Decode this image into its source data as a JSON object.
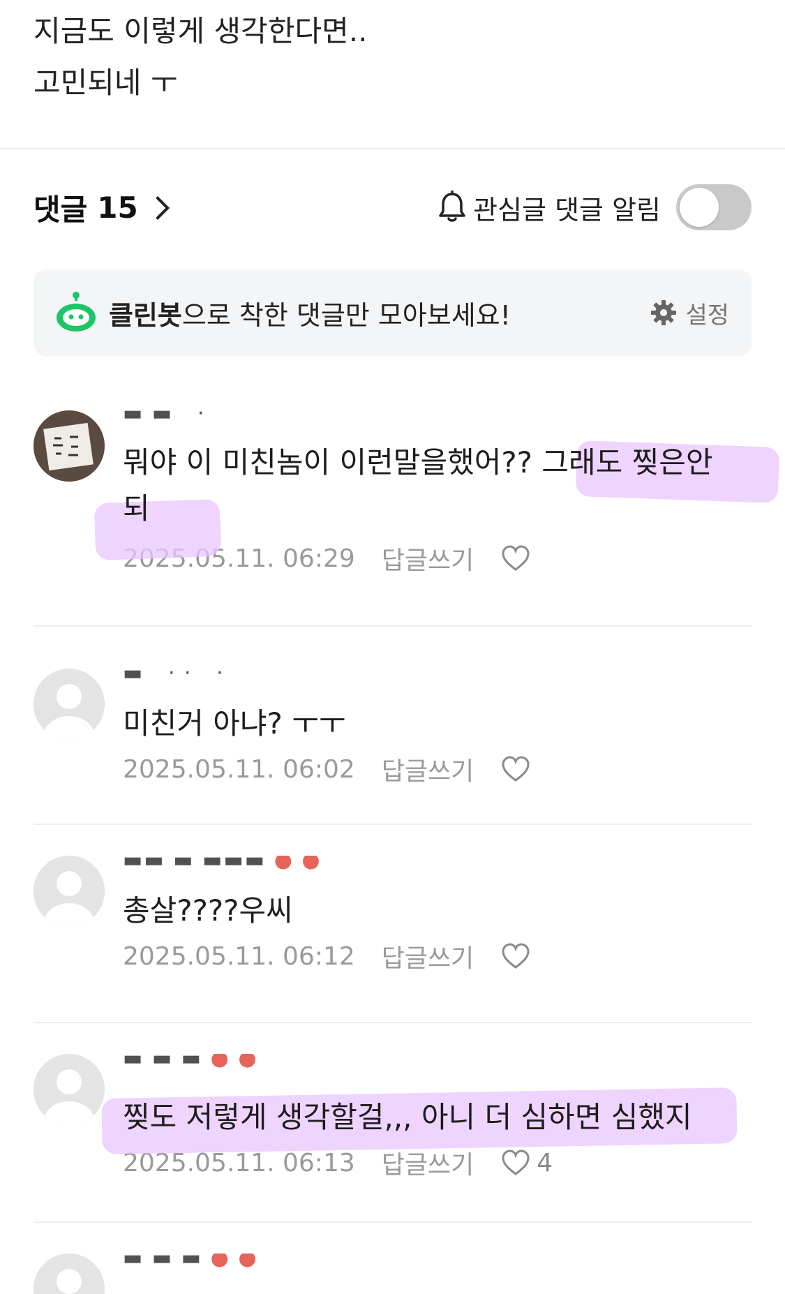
{
  "post": {
    "lines": [
      "지금도 이렇게 생각한다면..",
      "고민되네 ㅜ"
    ]
  },
  "comments_header": {
    "title": "댓글",
    "count": "15",
    "alert_label": "관심글 댓글 알림",
    "alert_enabled": false
  },
  "cleanbot": {
    "brand": "클린봇",
    "message": "으로 착한 댓글만 모아보세요!",
    "settings_label": "설정",
    "icon_color": "#1ec567"
  },
  "comments": [
    {
      "text_lines": [
        "뭐야 이 미친놈이 이런말을했어?? 그래도 찢은안",
        "되"
      ],
      "date": "2025.05.11. 06:29",
      "reply_label": "답글쓰기",
      "likes": ""
    },
    {
      "text_lines": [
        "미친거 아냐? ㅜㅜ"
      ],
      "date": "2025.05.11. 06:02",
      "reply_label": "답글쓰기",
      "likes": ""
    },
    {
      "text_lines": [
        "총살????우씨"
      ],
      "date": "2025.05.11. 06:12",
      "reply_label": "답글쓰기",
      "likes": ""
    },
    {
      "text_lines": [
        "찢도 저렇게 생각할걸,,, 아니 더 심하면 심했지"
      ],
      "date": "2025.05.11. 06:13",
      "reply_label": "답글쓰기",
      "likes": "4"
    }
  ],
  "colors": {
    "highlight": "#e9c6ff",
    "meta_text": "#9a9a9a",
    "banner_bg": "#f4f5f7"
  }
}
